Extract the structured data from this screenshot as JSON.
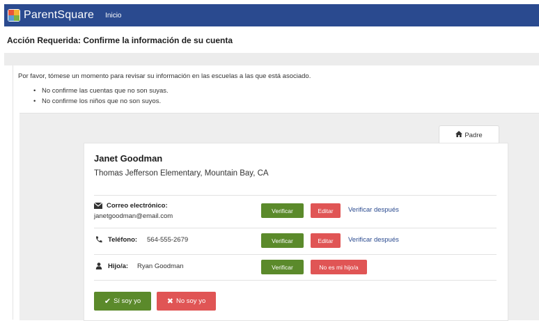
{
  "app": {
    "brand": "ParentSquare",
    "nav_inicio": "Inicio"
  },
  "page": {
    "title": "Acción Requerida: Confirme la información de su cuenta",
    "intro": "Por favor, tómese un momento para revisar su información en las escuelas a las que está asociado.",
    "bullets": [
      "No confirme las cuentas que no son suyas.",
      "No confirme los niños que no son suyos."
    ]
  },
  "tab": {
    "label": "Padre",
    "icon": "home-icon"
  },
  "account": {
    "name": "Janet Goodman",
    "school": "Thomas Jefferson Elementary, Mountain Bay, CA",
    "email": {
      "label": "Correo electrónico:",
      "value": "janetgoodman@email.com",
      "icon": "envelope-icon",
      "verify_label": "Verificar",
      "edit_label": "Editar",
      "later_label": "Verificar después"
    },
    "phone": {
      "label": "Teléfono:",
      "value": "564-555-2679",
      "icon": "phone-icon",
      "verify_label": "Verificar",
      "edit_label": "Editar",
      "later_label": "Verificar después"
    },
    "child": {
      "label": "Hijo/a:",
      "value": "Ryan Goodman",
      "icon": "person-icon",
      "verify_label": "Verificar",
      "not_mine_label": "No es mi hijo/a"
    }
  },
  "actions": {
    "yes_label": "Sí soy yo",
    "no_label": "No soy yo"
  },
  "colors": {
    "topbar": "#2a4a8f",
    "verify_green": "#5b8a2b",
    "edit_red": "#e05555",
    "link_blue": "#2a4a8f"
  }
}
